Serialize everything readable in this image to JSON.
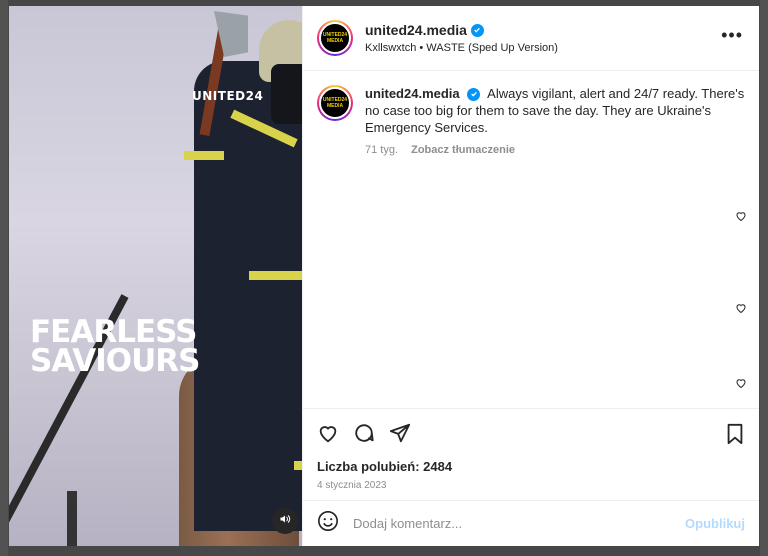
{
  "post": {
    "username": "united24.media",
    "audio": "Kxllswxtch • WASTE (Sped Up Version)",
    "avatar_text": "UNITED24 MEDIA",
    "more_label": "•••"
  },
  "media": {
    "watermark": "UNITED24",
    "headline_line1": "FEARLESS",
    "headline_line2": "SAVIOURS"
  },
  "caption": {
    "username": "united24.media",
    "text": "Always vigilant, alert and 24/7 ready. There's no case too big for them to save the day. They are Ukraine's Emergency Services.",
    "age": "71 tyg.",
    "translate_label": "Zobacz tłumaczenie"
  },
  "engagement": {
    "likes_text": "Liczba polubień: 2484",
    "date": "4 stycznia 2023"
  },
  "comment": {
    "placeholder": "Dodaj komentarz...",
    "publish_label": "Opublikuj"
  },
  "icons": {
    "like": "heart-icon",
    "comment": "comment-icon",
    "share": "share-icon",
    "save": "bookmark-icon",
    "emoji": "emoji-icon",
    "sound": "speaker-icon",
    "verified": "verified-badge-icon"
  },
  "colors": {
    "verified": "#0095f6",
    "publish_disabled": "#b3dbff",
    "muted_text": "#8e8e8e"
  }
}
